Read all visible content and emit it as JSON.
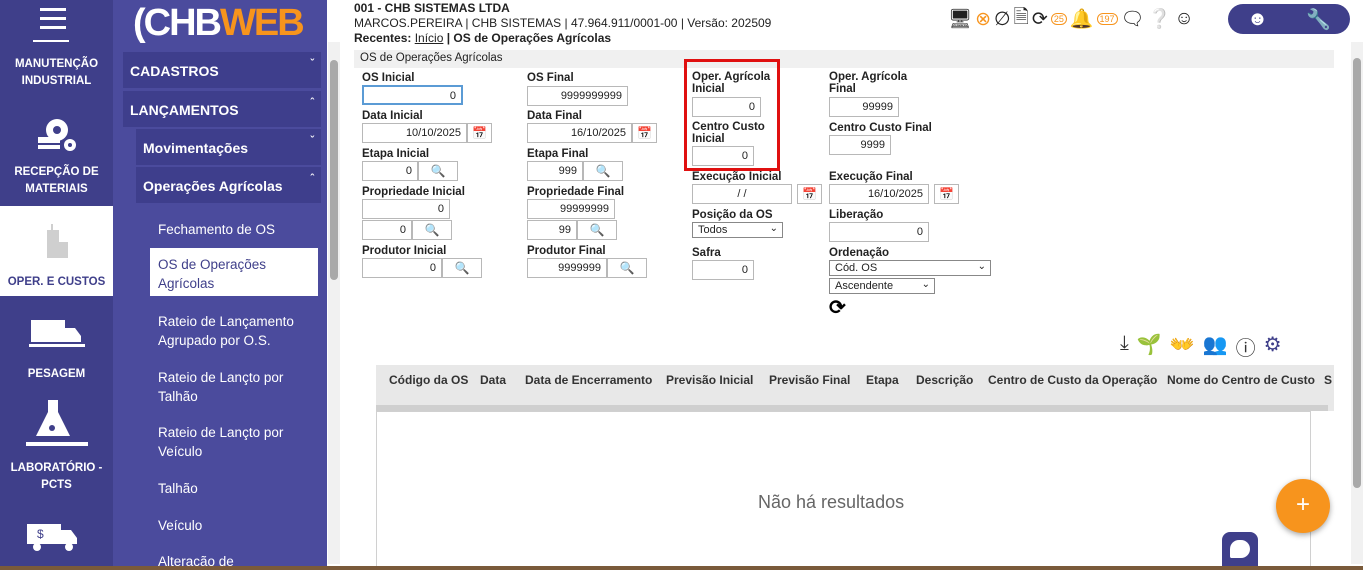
{
  "rail": {
    "items": [
      {
        "label_1": "MANUTENÇÃO",
        "label_2": "INDUSTRIAL"
      },
      {
        "label_1": "RECEPÇÃO DE",
        "label_2": "MATERIAIS"
      },
      {
        "label_1": "OPER. E CUSTOS",
        "label_2": ""
      },
      {
        "label_1": "PESAGEM",
        "label_2": ""
      },
      {
        "label_1": "LABORATÓRIO -",
        "label_2": "PCTS"
      }
    ]
  },
  "logo": {
    "prefix": "CHB",
    "suffix": "WEB",
    "mark": "("
  },
  "menu": {
    "cadastros": "CADASTROS",
    "lancamentos": "LANÇAMENTOS",
    "movimentacoes": "Movimentações",
    "operacoes": "Operações Agrícolas",
    "leaves": [
      "Fechamento de OS",
      "OS de Operações Agrícolas",
      "Rateio de Lançamento Agrupado por O.S.",
      "Rateio de Lançto por Talhão",
      "Rateio de Lançto por Veículo",
      "Talhão",
      "Veículo",
      "Alteração de"
    ]
  },
  "header": {
    "company": "001 - CHB SISTEMAS LTDA",
    "user_line": "MARCOS.PEREIRA | CHB SISTEMAS | 47.964.911/0001-00 | Versão: 202509",
    "recent_label": "Recentes:",
    "recent_link": "Início",
    "recent_current": "| OS de Operações Agrícolas",
    "badge_25": "25",
    "badge_197": "197"
  },
  "form": {
    "title": "OS de Operações Agrícolas",
    "os_inicial": {
      "label": "OS Inicial",
      "value": "0"
    },
    "os_final": {
      "label": "OS Final",
      "value": "9999999999"
    },
    "oper_inicial": {
      "label_1": "Oper. Agrícola",
      "label_2": "Inicial",
      "value": "0"
    },
    "oper_final": {
      "label_1": "Oper. Agrícola",
      "label_2": "Final",
      "value": "99999"
    },
    "data_inicial": {
      "label": "Data Inicial",
      "value": "10/10/2025"
    },
    "data_final": {
      "label": "Data Final",
      "value": "16/10/2025"
    },
    "cc_inicial": {
      "label_1": "Centro Custo",
      "label_2": "Inicial",
      "value": "0"
    },
    "cc_final": {
      "label": "Centro Custo Final",
      "value": "9999"
    },
    "etapa_inicial": {
      "label": "Etapa Inicial",
      "value": "0"
    },
    "etapa_final": {
      "label": "Etapa Final",
      "value": "999"
    },
    "exec_inicial": {
      "label": "Execução Inicial",
      "value": "/  /"
    },
    "exec_final": {
      "label": "Execução Final",
      "value": "16/10/2025"
    },
    "prop_inicial": {
      "label": "Propriedade Inicial",
      "value": "0",
      "value2": "0"
    },
    "prop_final": {
      "label": "Propriedade Final",
      "value": "99999999",
      "value2": "99"
    },
    "posicao": {
      "label": "Posição da OS",
      "value": "Todos"
    },
    "liberacao": {
      "label": "Liberação",
      "value": "0"
    },
    "prod_inicial": {
      "label": "Produtor Inicial",
      "value": "0"
    },
    "prod_final": {
      "label": "Produtor Final",
      "value": "9999999"
    },
    "safra": {
      "label": "Safra",
      "value": "0"
    },
    "ordenacao": {
      "label": "Ordenação",
      "value": "Cód. OS",
      "direction": "Ascendente"
    }
  },
  "table": {
    "columns": [
      "Código da OS",
      "Data",
      "Data de Encerramento",
      "Previsão Inicial",
      "Previsão Final",
      "Etapa",
      "Descrição",
      "Centro de Custo da Operação",
      "Nome do Centro de Custo",
      "S"
    ],
    "empty": "Não há resultados"
  },
  "fab": "+"
}
